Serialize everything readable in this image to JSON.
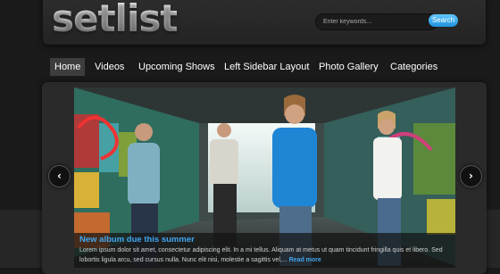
{
  "header": {
    "logo": "setlist",
    "search": {
      "placeholder": "Enter keywords...",
      "button_label": "Search"
    }
  },
  "nav": {
    "items": [
      {
        "label": "Home",
        "active": true
      },
      {
        "label": "Videos"
      },
      {
        "label": "Upcoming Shows"
      },
      {
        "label": "Left Sidebar Layout"
      },
      {
        "label": "Photo Gallery"
      },
      {
        "label": "Categories"
      }
    ]
  },
  "slider": {
    "prev_icon": "chevron-left-icon",
    "next_icon": "chevron-right-icon",
    "caption": {
      "title": "New album due this summer",
      "text": "Lorem ipsum dolor sit amet, consectetur adipiscing elit. In a mi tellus. Aliquam at metus ut quam tincidunt fringilla quis et libero. Sed lobortis ligula arcu, sed cursus nulla. Nunc elit nisi, molestie a sagittis vel,...",
      "read_more": "Read more"
    }
  },
  "colors": {
    "accent": "#42a7f0",
    "background": "#1a1a1a",
    "search_button": "#2a9fe8"
  }
}
